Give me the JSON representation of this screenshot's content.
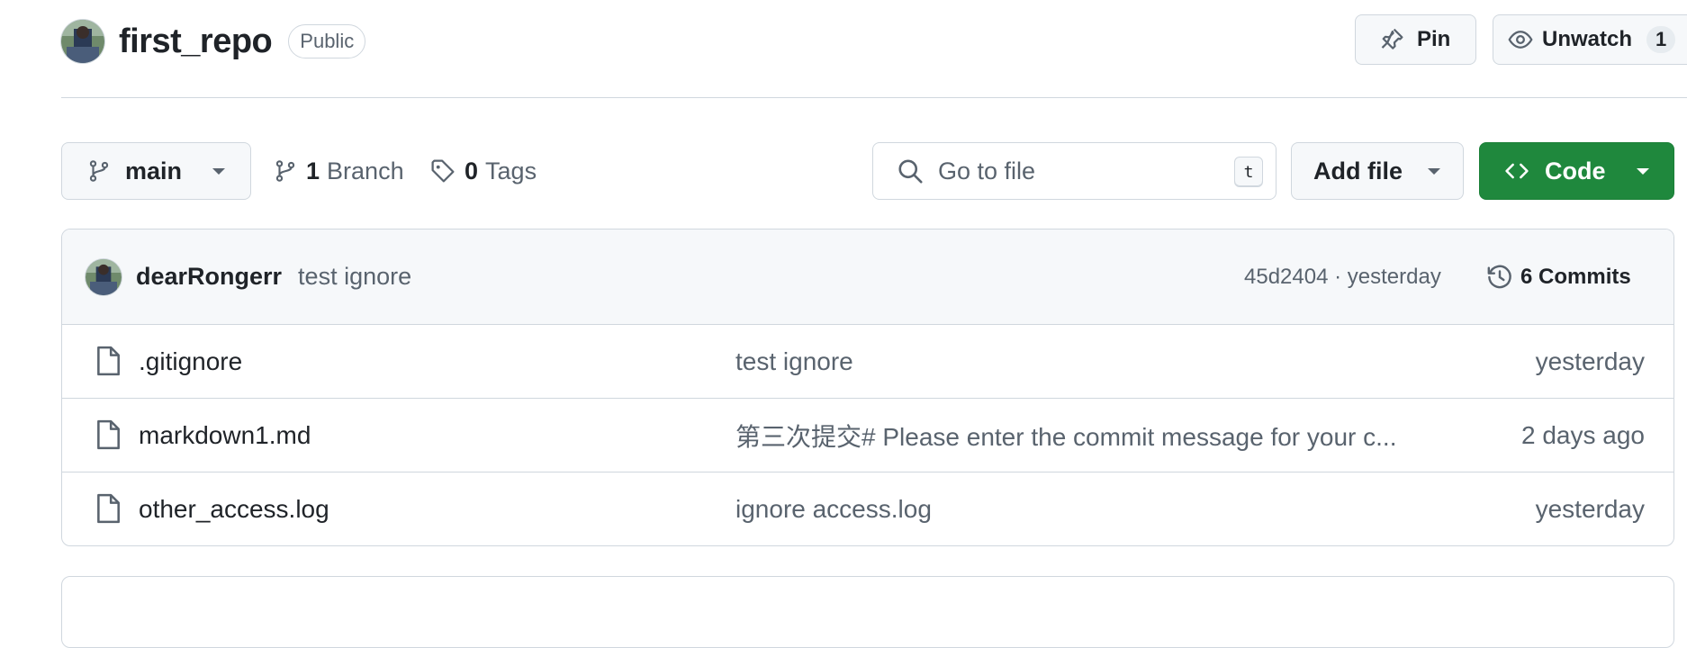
{
  "repo": {
    "name": "first_repo",
    "visibility": "Public"
  },
  "actions": {
    "pin_label": "Pin",
    "watch_label": "Unwatch",
    "watch_count": "1"
  },
  "toolbar": {
    "branch": "main",
    "branch_count": "1",
    "branch_label": "Branch",
    "tag_count": "0",
    "tag_label": "Tags",
    "search_placeholder": "Go to file",
    "search_shortcut": "t",
    "add_file_label": "Add file",
    "code_label": "Code"
  },
  "latest_commit": {
    "author": "dearRongerr",
    "message": "test ignore",
    "sha_time": "45d2404 · yesterday",
    "commits_label": "6 Commits"
  },
  "files": [
    {
      "name": ".gitignore",
      "commit": "test ignore",
      "date": "yesterday"
    },
    {
      "name": "markdown1.md",
      "commit": "第三次提交# Please enter the commit message for your c...",
      "date": "2 days ago"
    },
    {
      "name": "other_access.log",
      "commit": "ignore access.log",
      "date": "yesterday"
    }
  ],
  "colors": {
    "primary_button": "#1f883d",
    "border": "#d0d7de",
    "muted_text": "#59636e"
  }
}
